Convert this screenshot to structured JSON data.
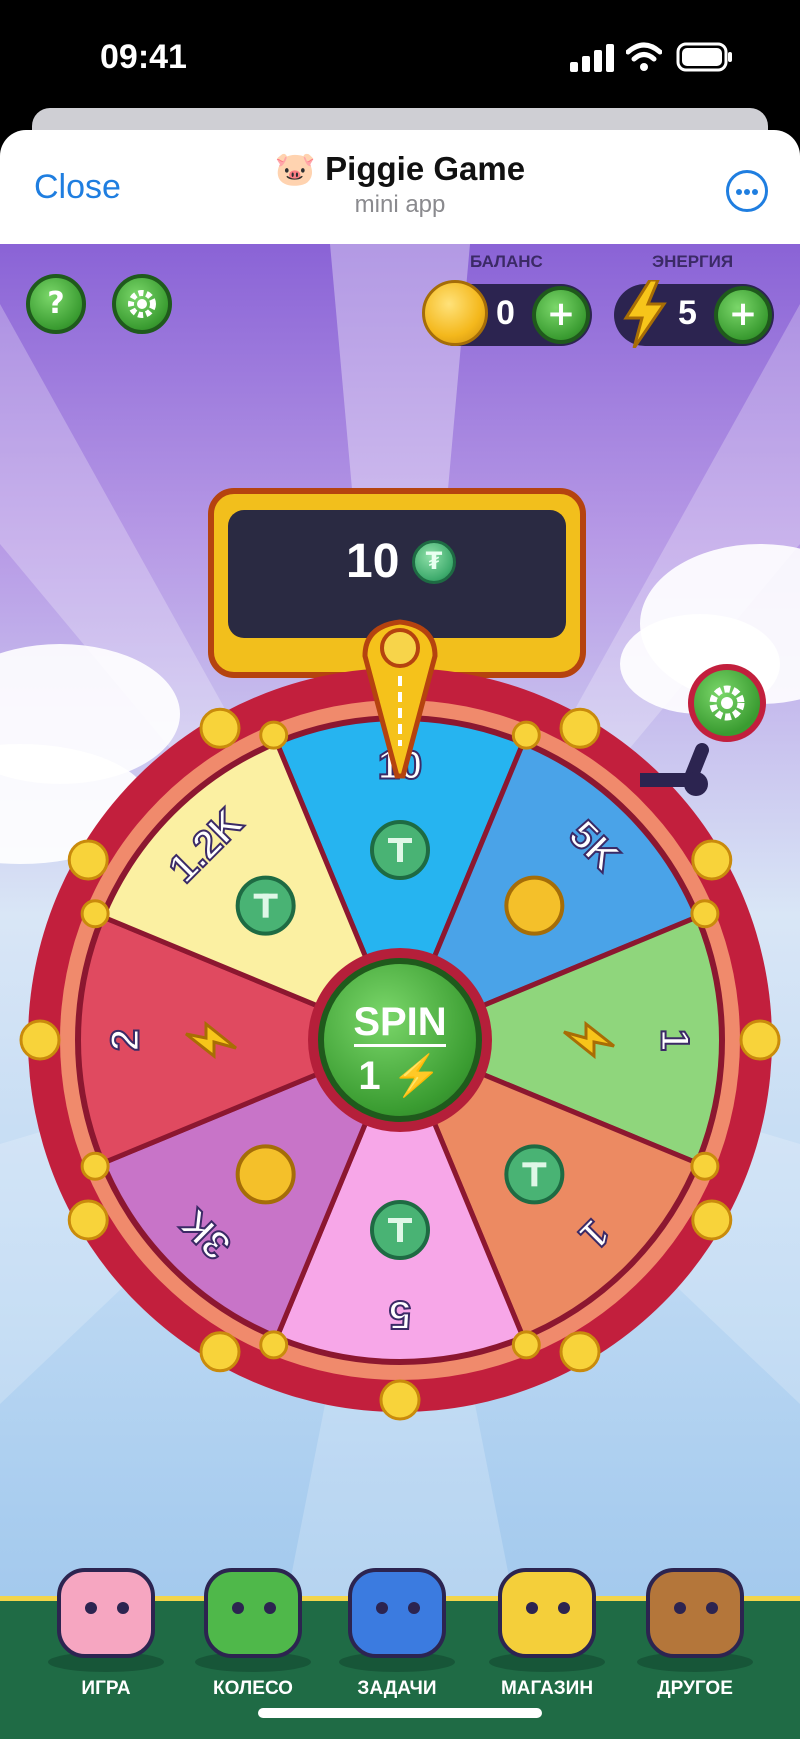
{
  "status_bar": {
    "time": "09:41"
  },
  "header": {
    "close_label": "Close",
    "title_emoji": "🐷",
    "title": "Piggie Game",
    "subtitle": "mini app"
  },
  "hud": {
    "balance_label": "БАЛАНС",
    "balance_value": "0",
    "energy_label": "ЭНЕРГИЯ",
    "energy_value": "5",
    "help_glyph": "?"
  },
  "prize_display": {
    "value": "10"
  },
  "wheel": {
    "segments": [
      {
        "label": "10",
        "reward": "tether",
        "color": "#26b4f0"
      },
      {
        "label": "5K",
        "reward": "coin",
        "color": "#4aa3e8"
      },
      {
        "label": "1",
        "reward": "energy",
        "color": "#8fd67c"
      },
      {
        "label": "1",
        "reward": "tether",
        "color": "#ec8a62"
      },
      {
        "label": "5",
        "reward": "tether",
        "color": "#f7a7e8"
      },
      {
        "label": "3K",
        "reward": "coin",
        "color": "#c874c8"
      },
      {
        "label": "2",
        "reward": "energy",
        "color": "#e04a60"
      },
      {
        "label": "1.2K",
        "reward": "tether",
        "color": "#fbf0a2"
      }
    ],
    "spin_label": "SPIN",
    "spin_cost": "1"
  },
  "nav": {
    "items": [
      {
        "label": "ИГРА",
        "icon": "piggy-bank-icon"
      },
      {
        "label": "КОЛЕСО",
        "icon": "clover-icon"
      },
      {
        "label": "ЗАДАЧИ",
        "icon": "clipboard-icon"
      },
      {
        "label": "МАГАЗИН",
        "icon": "cash-register-icon"
      },
      {
        "label": "ДРУГОЕ",
        "icon": "toy-box-icon"
      }
    ]
  }
}
